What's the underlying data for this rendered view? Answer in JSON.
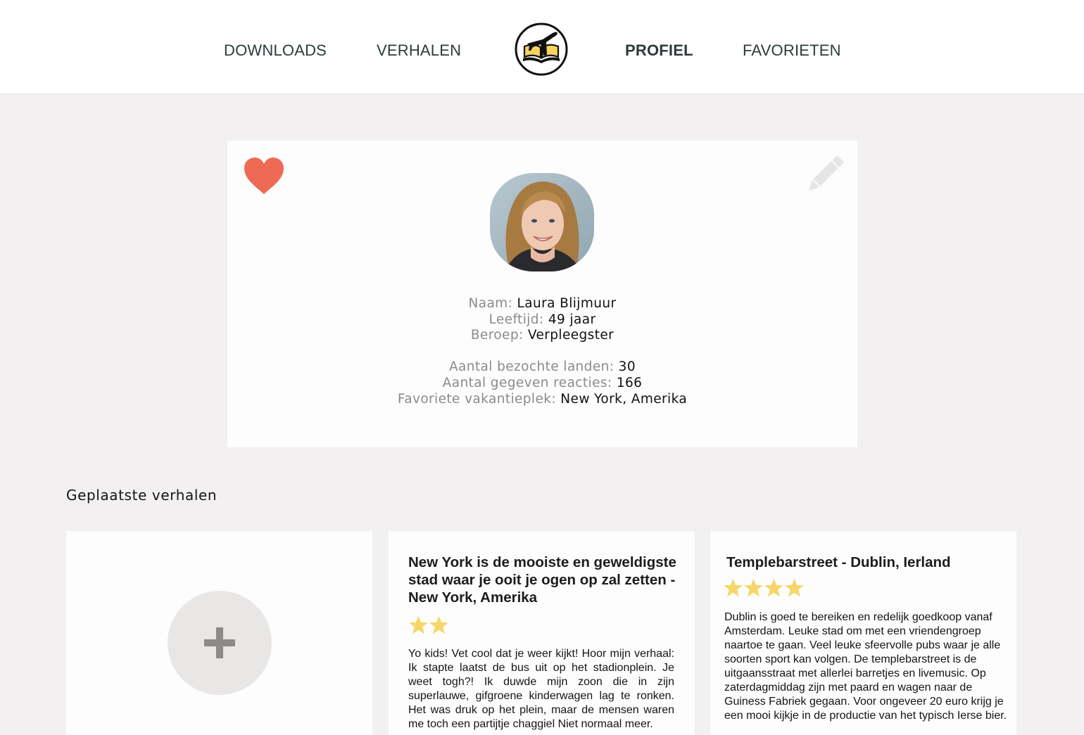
{
  "nav": {
    "downloads": "DOWNLOADS",
    "verhalen": "VERHALEN",
    "profiel": "PROFIEL",
    "favorieten": "FAVORIETEN"
  },
  "profile": {
    "naam_label": "Naam:",
    "naam": "Laura Blijmuur",
    "leeftijd_label": "Leeftijd:",
    "leeftijd": "49 jaar",
    "beroep_label": "Beroep:",
    "beroep": "Verpleegster",
    "landen_label": "Aantal bezochte landen:",
    "landen": "30",
    "reacties_label": "Aantal gegeven reacties:",
    "reacties": "166",
    "vakantieplek_label": "Favoriete vakantieplek:",
    "vakantieplek": "New York, Amerika"
  },
  "section": {
    "title": "Geplaatste verhalen"
  },
  "add_story": {
    "symbol": "+"
  },
  "stories": [
    {
      "title": "New York is de mooiste en geweldigste stad waar je ooit je ogen op zal zetten - New York, Amerika",
      "rating": 2,
      "body": "Yo kids! Vet cool dat je weer kijkt! Hoor mijn verhaal: Ik stapte laatst de bus uit op het stadionplein. Je weet togh?! Ik duwde mijn zoon die in zijn superlauwe, gifgroene kinderwagen lag te ronken. Het was druk op het plein, maar de mensen waren me toch een partijtje chaggiel Niet normaal meer."
    },
    {
      "title": "Templebarstreet - Dublin, Ierland",
      "rating": 4,
      "body": "Dublin is goed te bereiken en redelijk goedkoop vanaf Amsterdam. Leuke stad om met een vriendengroep naartoe te gaan. Veel leuke sfeervolle pubs waar je alle soorten sport kan volgen. De templebarstreet is de uitgaansstraat met allerlei barretjes en livemusic. Op zaterdagmiddag zijn met paard en wagen naar de Guiness Fabriek gegaan. Voor ongeveer 20 euro krijg je een mooi kijkje in de productie van het typisch Ierse bier."
    }
  ],
  "colors": {
    "heart": "#ee6a55",
    "star": "#f6d66a",
    "pencil": "#e6e4e4",
    "background": "#f2f0f0"
  },
  "icons": {
    "logo": "book-airplane-logo",
    "favorite": "heart-icon",
    "edit": "pencil-icon",
    "add": "plus-icon",
    "rating": "star-icon"
  }
}
